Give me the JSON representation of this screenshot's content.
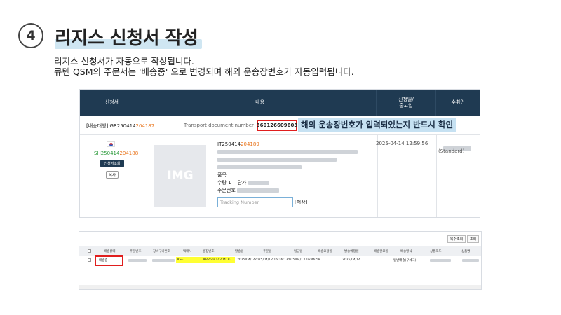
{
  "step": {
    "number": "4"
  },
  "title": "리지스 신청서 작성",
  "description": {
    "line1": "리지스 신청서가 자동으로 작성됩니다.",
    "line2": "큐텐 QSM의 주문서는 '배송중' 으로 변경되며 해외 운송장번호가 자동입력됩니다."
  },
  "app_shot": {
    "header": {
      "col1": "신청서",
      "col2": "내용",
      "col3_line1": "신청일/",
      "col3_line2": "출고일",
      "col4": "수취인"
    },
    "order": {
      "prefix": "[배송대행]",
      "code_main": "GR250414",
      "code_suffix": "204187"
    },
    "transport_label": "Transport document number",
    "transport_number": "360126609603",
    "annotation": "해외 운송장번호가 입력되었는지 반드시 확인",
    "shipment": {
      "code_main": "SH250414",
      "code_suffix": "204188",
      "view_button": "신청서조회",
      "copy_button": "복사"
    },
    "image_placeholder": "IMG",
    "item": {
      "code_main": "IT250414",
      "code_suffix": "204189",
      "name_label": "품목",
      "qty_label": "수량 1",
      "price_label": "단가",
      "order_no_label": "주문번호"
    },
    "tracking_placeholder": "Tracking Number",
    "save_label": "[저장]",
    "date": "2025-04-14 12:59:56",
    "recipient_grade": "(Standard)"
  },
  "qsm_shot": {
    "toolbar": {
      "reprint": "복수조회",
      "view": "조회"
    },
    "headers": [
      "배송상태",
      "주문번호",
      "장바구니번호",
      "택배사",
      "송장번호",
      "발송일",
      "주문일",
      "입금일",
      "배송요청일",
      "발송예정일",
      "배송완료일",
      "배송방식",
      "상품코드",
      "상품명"
    ],
    "row": {
      "status": "배송중",
      "courier": "KSE",
      "invoice": "KR250414204187",
      "ship_date": "2025/04/14",
      "order_date": "2025/04/12 16:16:13",
      "paid_date": "2025/04/13 16:46:58",
      "expected_ship": "2025/04/14",
      "method": "일반배송(우체국)"
    }
  },
  "colors": {
    "header_bg": "#1f3a52",
    "accent_orange": "#e8741c",
    "accent_green": "#2a9a3a",
    "highlight_blue": "#c6e1f2",
    "alert_red": "#e01e1e",
    "highlight_yellow": "#ffff33"
  }
}
